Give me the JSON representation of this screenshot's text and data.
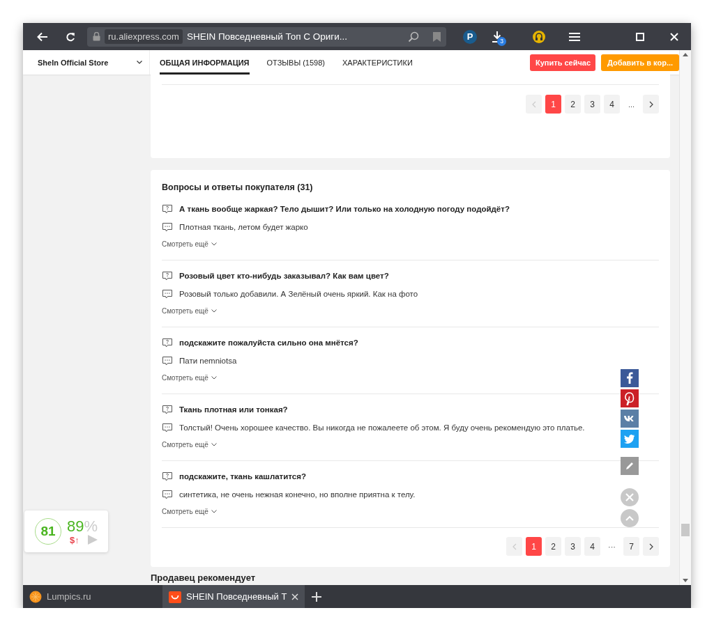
{
  "browser": {
    "address": {
      "domain": "ru.aliexpress.com",
      "page_title": "SHEIN Повседневный Топ С Ориги..."
    },
    "extension_letter": "P",
    "download_count": "3",
    "tabs": [
      {
        "label": "Lumpics.ru",
        "selected": false,
        "kind": "orange"
      },
      {
        "label": "SHEIN Повседневный Т",
        "selected": true,
        "kind": "shop"
      }
    ]
  },
  "header": {
    "store": "SheIn Official Store",
    "tabs": [
      {
        "label": "ОБЩАЯ ИНФОРМАЦИЯ",
        "selected": true
      },
      {
        "label": "ОТЗЫВЫ (1598)",
        "selected": false
      },
      {
        "label": "ХАРАКТЕРИСТИКИ",
        "selected": false
      }
    ],
    "buttons": [
      {
        "label": "Купить сейчас",
        "kind": "buy"
      },
      {
        "label": "Добавить в кор...",
        "kind": "cart"
      }
    ]
  },
  "reviews_pager": {
    "prev_disabled": true,
    "items": [
      {
        "label": "1",
        "kind": "page",
        "selected": true
      },
      {
        "label": "2",
        "kind": "page",
        "selected": false
      },
      {
        "label": "3",
        "kind": "page",
        "selected": false
      },
      {
        "label": "4",
        "kind": "page",
        "selected": false
      },
      {
        "label": "...",
        "kind": "ellipsis"
      }
    ]
  },
  "qa": {
    "title": "Вопросы и ответы покупателя (31)",
    "items": [
      {
        "question": "А ткань вообще жаркая? Тело дышит? Или только на холодную погоду подойдёт?",
        "answer": "Плотная ткань, летом будет жарко",
        "more": "Смотреть ещё"
      },
      {
        "question": "Розовый цвет кто-нибудь заказывал? Как вам цвет?",
        "answer": "Розовый только добавили. А Зелёный очень яркий. Как на фото",
        "more": "Смотреть ещё"
      },
      {
        "question": "подскажите пожалуйста сильно она мнётся?",
        "answer": "Пати nemniotsa",
        "more": "Смотреть ещё"
      },
      {
        "question": "Ткань плотная или тонкая?",
        "answer": "Толстый! Очень хорошее качество. Вы никогда не пожалеете об этом. Я буду очень рекомендую это платье.",
        "more": "Смотреть ещё"
      },
      {
        "question": "подскажите, ткань кашлатится?",
        "answer": "синтетика, не очень нежная конечно, но вполне приятна к телу.",
        "more": "Смотреть ещё"
      }
    ],
    "pager": {
      "prev_disabled": true,
      "items": [
        {
          "label": "1",
          "kind": "page",
          "selected": true
        },
        {
          "label": "2",
          "kind": "page",
          "selected": false
        },
        {
          "label": "3",
          "kind": "page",
          "selected": false
        },
        {
          "label": "4",
          "kind": "page",
          "selected": false
        },
        {
          "label": "···",
          "kind": "ellipsis"
        },
        {
          "label": "7",
          "kind": "page",
          "selected": false
        }
      ]
    }
  },
  "next_heading": "Продавец рекомендует",
  "rating_widget": {
    "score": "81",
    "percent": "89",
    "percent_sign": "%",
    "price_trend": "$↑"
  }
}
